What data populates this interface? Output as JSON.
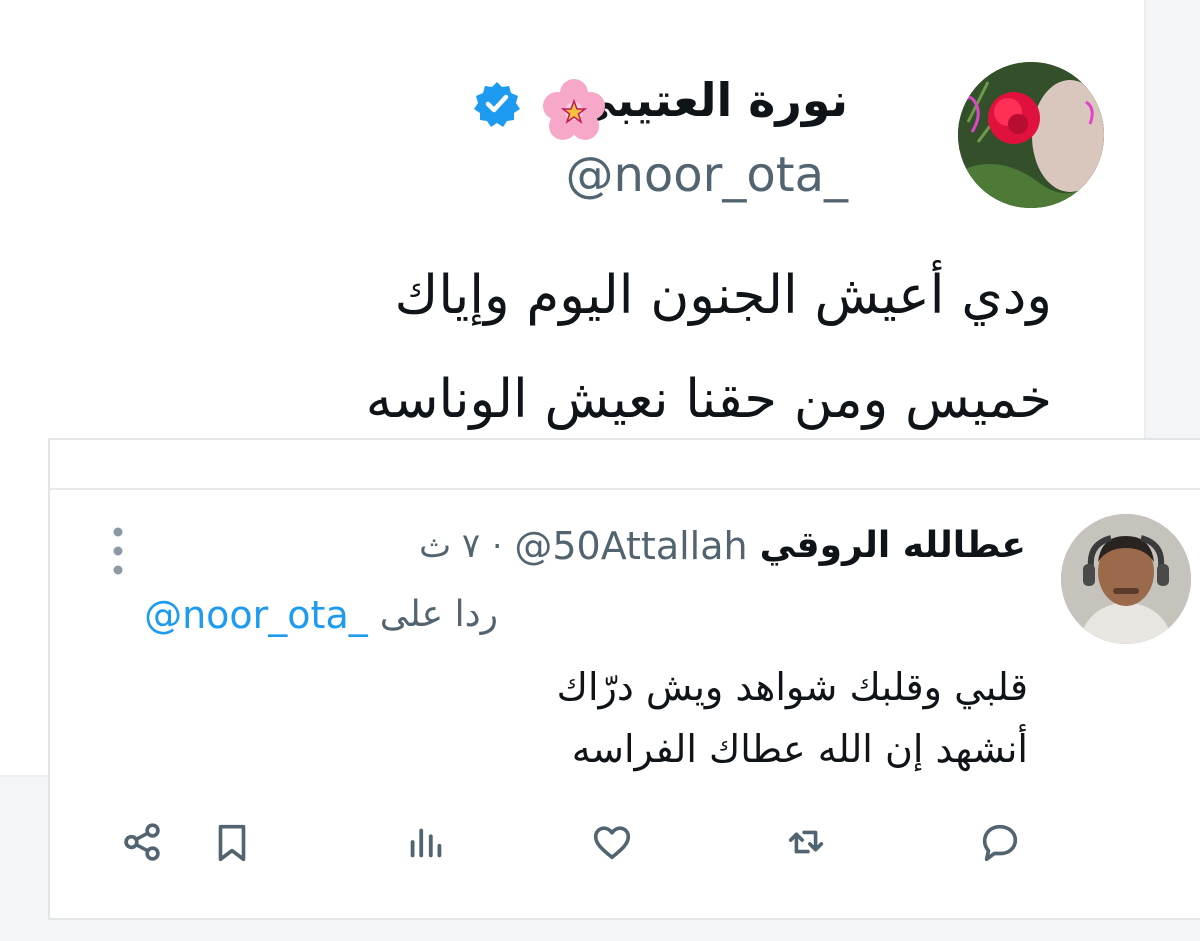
{
  "original_tweet": {
    "author_name": "نورة العتيبي",
    "handle": "@noor_ota_",
    "text_lines": [
      "ودي أعيش الجنون اليوم وإياك",
      "خميس ومن حقنا نعيش الوناسه"
    ],
    "icons": [
      "flower-emoji-icon",
      "verified-badge-icon"
    ]
  },
  "reply": {
    "author_name": "عطالله الروقي",
    "handle": "@50Attallah",
    "separator": "·",
    "time": "٧ ث",
    "replying_to_label": "ردا على",
    "replying_to_handle": "@noor_ota_",
    "text_lines": [
      "قلبي وقلبك شواهد ويش درّاك",
      "أنشهد إن الله عطاك الفراسه"
    ],
    "actions": [
      "reply-icon",
      "retweet-icon",
      "like-icon",
      "views-icon",
      "bookmark-icon",
      "share-icon"
    ]
  },
  "colors": {
    "verified": "#1d9bf0",
    "link": "#1d9bf0",
    "secondary_text": "#536471",
    "icon": "#536471"
  }
}
